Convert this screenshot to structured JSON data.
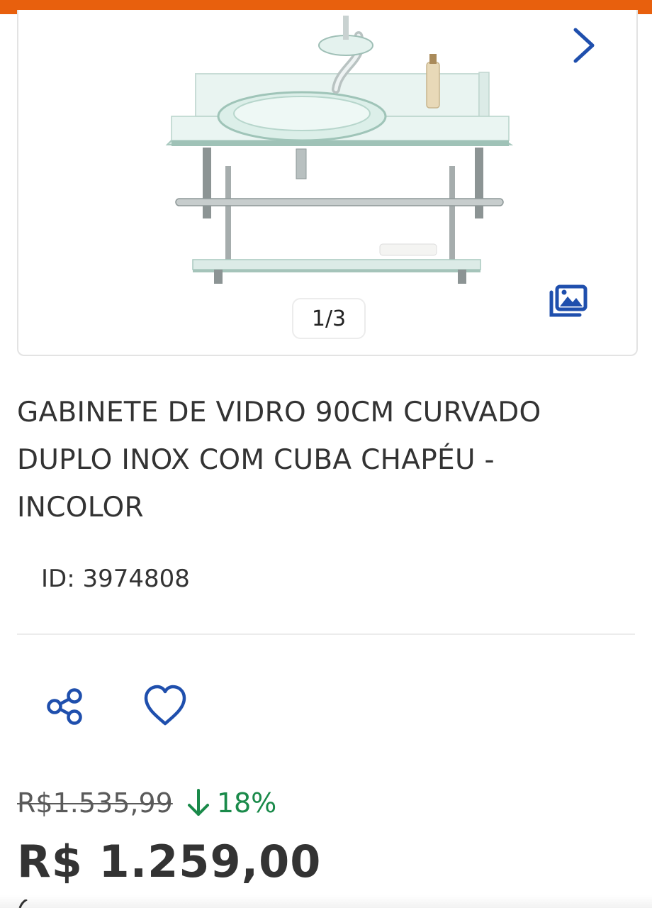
{
  "colors": {
    "brand_orange": "#e8600d",
    "link_blue": "#1f4fad",
    "discount_green": "#1a8a4a",
    "text": "#333333"
  },
  "gallery": {
    "counter": "1/3",
    "next_icon": "chevron-right-icon",
    "gallery_icon": "image-gallery-icon"
  },
  "product": {
    "title": "GABINETE DE VIDRO 90CM CURVADO DUPLO INOX COM CUBA CHAPÉU - INCOLOR",
    "id_label": "ID:",
    "id_value": "3974808"
  },
  "actions": {
    "share_icon": "share-icon",
    "favorite_icon": "heart-icon"
  },
  "pricing": {
    "old_price": "R$1.535,99",
    "discount": "18%",
    "discount_icon": "arrow-down-icon",
    "price": "R$ 1.259,00"
  }
}
